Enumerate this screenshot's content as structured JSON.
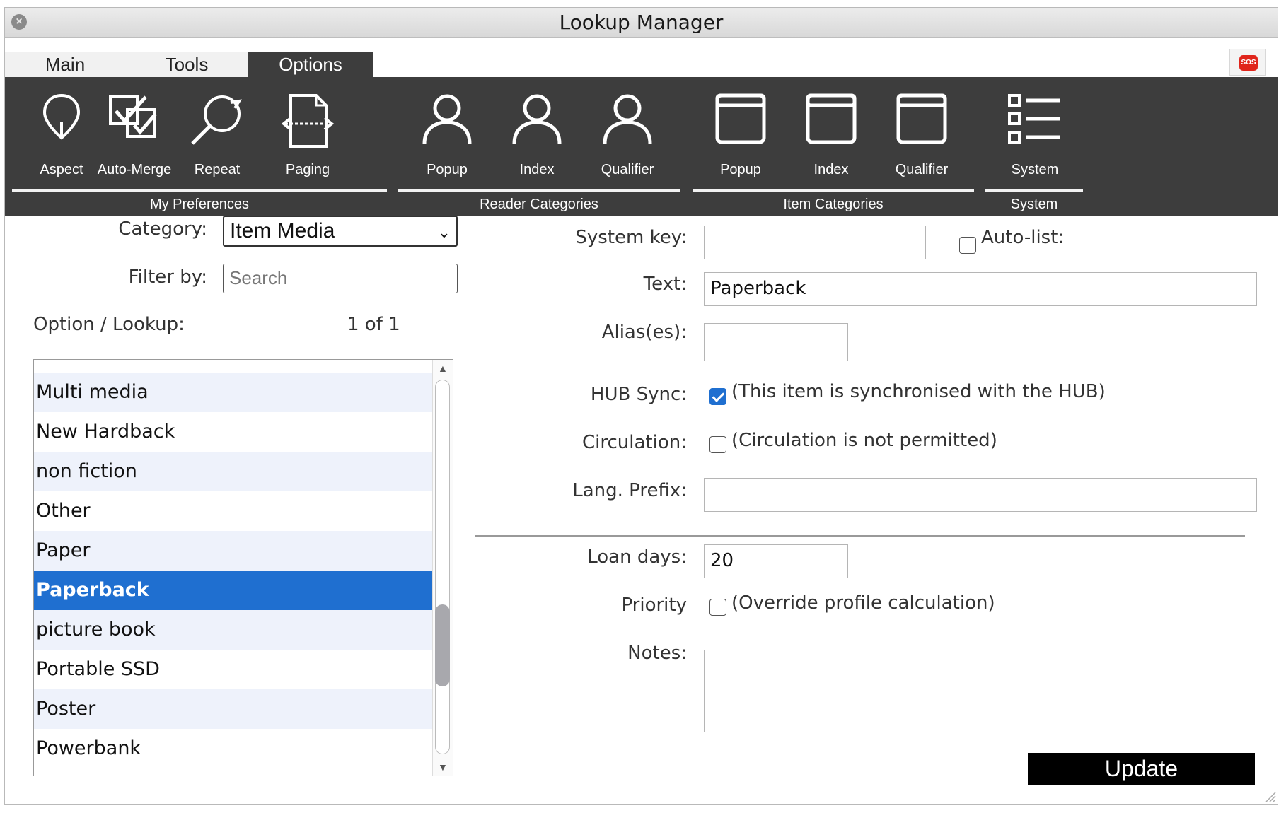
{
  "window": {
    "title": "Lookup Manager"
  },
  "tabs": [
    {
      "label": "Main"
    },
    {
      "label": "Tools"
    },
    {
      "label": "Options"
    }
  ],
  "sos_label": "SOS",
  "toolbar": {
    "buttons": [
      {
        "label": "Aspect",
        "icon": "map-pin-icon"
      },
      {
        "label": "Auto-Merge",
        "icon": "auto-merge-icon"
      },
      {
        "label": "Repeat",
        "icon": "repeat-search-icon"
      },
      {
        "label": "Paging",
        "icon": "paging-icon"
      },
      {
        "label": "Popup",
        "icon": "person-icon"
      },
      {
        "label": "Index",
        "icon": "person-icon"
      },
      {
        "label": "Qualifier",
        "icon": "person-icon"
      },
      {
        "label": "Popup",
        "icon": "window-icon"
      },
      {
        "label": "Index",
        "icon": "window-icon"
      },
      {
        "label": "Qualifier",
        "icon": "window-icon"
      },
      {
        "label": "System",
        "icon": "list-icon"
      }
    ],
    "groups": [
      {
        "label": "My Preferences"
      },
      {
        "label": "Reader Categories"
      },
      {
        "label": "Item Categories"
      },
      {
        "label": "System"
      }
    ]
  },
  "left": {
    "category_label": "Category:",
    "category_value": "Item Media",
    "filter_label": "Filter by:",
    "filter_placeholder": "Search",
    "option_lookup_label": "Option / Lookup:",
    "count": "1 of 1",
    "items": [
      {
        "label": "Multi media",
        "selected": false
      },
      {
        "label": "New Hardback",
        "selected": false
      },
      {
        "label": "non fiction",
        "selected": false
      },
      {
        "label": "Other",
        "selected": false
      },
      {
        "label": "Paper",
        "selected": false
      },
      {
        "label": "Paperback",
        "selected": true
      },
      {
        "label": "picture book",
        "selected": false
      },
      {
        "label": "Portable SSD",
        "selected": false
      },
      {
        "label": "Poster",
        "selected": false
      },
      {
        "label": "Powerbank",
        "selected": false
      }
    ]
  },
  "form": {
    "system_key_label": "System key:",
    "system_key_value": "",
    "auto_list_label": "Auto-list:",
    "auto_list_checked": false,
    "text_label": "Text:",
    "text_value": "Paperback",
    "alias_label": "Alias(es):",
    "alias_value": "",
    "hub_sync_label": "HUB Sync:",
    "hub_sync_checked": true,
    "hub_sync_text": "(This item is synchronised with the HUB)",
    "circulation_label": "Circulation:",
    "circulation_checked": false,
    "circulation_text": "(Circulation is not permitted)",
    "lang_prefix_label": "Lang. Prefix:",
    "lang_prefix_value": "",
    "loan_days_label": "Loan days:",
    "loan_days_value": "20",
    "priority_label": "Priority",
    "priority_checked": false,
    "priority_text": "(Override profile calculation)",
    "notes_label": "Notes:",
    "notes_value": "",
    "update_label": "Update"
  }
}
